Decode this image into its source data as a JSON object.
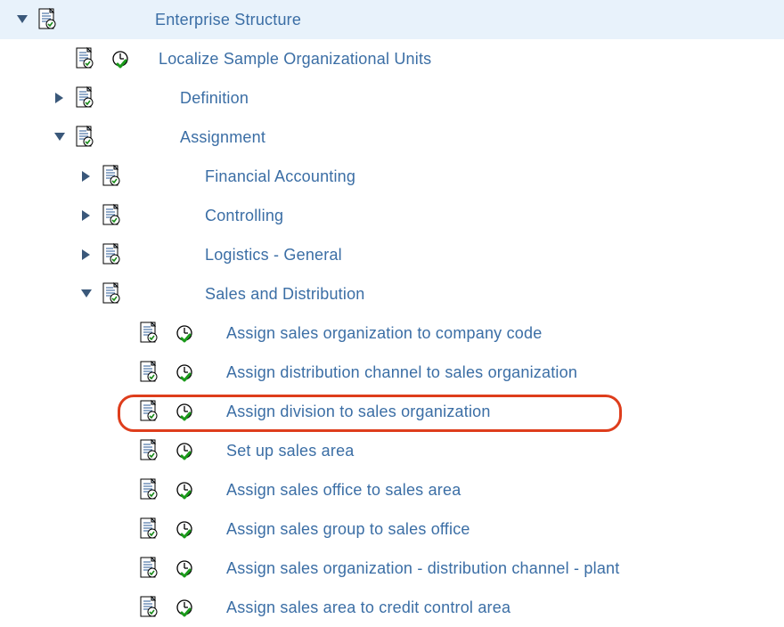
{
  "tree": {
    "root": {
      "label": "Enterprise Structure"
    },
    "localize": {
      "label": "Localize Sample Organizational Units"
    },
    "definition": {
      "label": "Definition"
    },
    "assignment": {
      "label": "Assignment"
    },
    "fi": {
      "label": "Financial Accounting"
    },
    "co": {
      "label": "Controlling"
    },
    "lo": {
      "label": "Logistics - General"
    },
    "sd": {
      "label": "Sales and Distribution"
    },
    "sd1": {
      "label": "Assign sales organization to company code"
    },
    "sd2": {
      "label": "Assign distribution channel to sales organization"
    },
    "sd3": {
      "label": "Assign division to sales organization"
    },
    "sd4": {
      "label": "Set up sales area"
    },
    "sd5": {
      "label": "Assign sales office to sales area"
    },
    "sd6": {
      "label": "Assign sales group to sales office"
    },
    "sd7": {
      "label": "Assign sales organization - distribution channel - plant"
    },
    "sd8": {
      "label": "Assign sales area to credit control area"
    }
  }
}
